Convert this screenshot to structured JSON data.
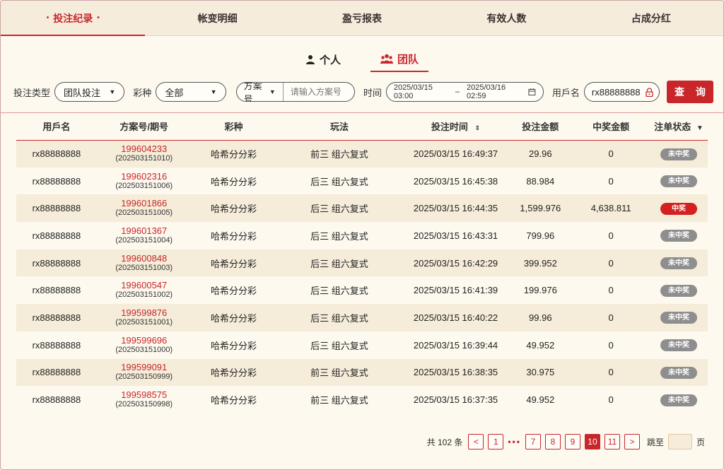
{
  "top_tabs": [
    "投注纪录",
    "帐变明细",
    "盈亏报表",
    "有效人数",
    "占成分红"
  ],
  "scope": {
    "personal": "个人",
    "team": "团队"
  },
  "filters": {
    "bet_type_label": "投注类型",
    "bet_type_value": "团队投注",
    "lottery_label": "彩种",
    "lottery_value": "全部",
    "plan_select": "方案号",
    "plan_placeholder": "请输入方案号",
    "time_label": "时间",
    "time_start": "2025/03/15 03:00",
    "time_sep": "–",
    "time_end": "2025/03/16 02:59",
    "user_label": "用戶名",
    "user_value": "rx88888888",
    "search_label": "查 询"
  },
  "table": {
    "headers": [
      "用戶名",
      "方案号/期号",
      "彩种",
      "玩法",
      "投注时间",
      "投注金额",
      "中奖金额",
      "注单状态"
    ],
    "rows": [
      {
        "user": "rx88888888",
        "order": "199604233",
        "period": "(202503151010)",
        "lottery": "哈希分分彩",
        "play": "前三 组六复式",
        "time": "2025/03/15 16:49:37",
        "bet": "29.96",
        "win": "0",
        "status": "未中奖"
      },
      {
        "user": "rx88888888",
        "order": "199602316",
        "period": "(202503151006)",
        "lottery": "哈希分分彩",
        "play": "后三 组六复式",
        "time": "2025/03/15 16:45:38",
        "bet": "88.984",
        "win": "0",
        "status": "未中奖"
      },
      {
        "user": "rx88888888",
        "order": "199601866",
        "period": "(202503151005)",
        "lottery": "哈希分分彩",
        "play": "后三 组六复式",
        "time": "2025/03/15 16:44:35",
        "bet": "1,599.976",
        "win": "4,638.811",
        "status": "中奖"
      },
      {
        "user": "rx88888888",
        "order": "199601367",
        "period": "(202503151004)",
        "lottery": "哈希分分彩",
        "play": "后三 组六复式",
        "time": "2025/03/15 16:43:31",
        "bet": "799.96",
        "win": "0",
        "status": "未中奖"
      },
      {
        "user": "rx88888888",
        "order": "199600848",
        "period": "(202503151003)",
        "lottery": "哈希分分彩",
        "play": "后三 组六复式",
        "time": "2025/03/15 16:42:29",
        "bet": "399.952",
        "win": "0",
        "status": "未中奖"
      },
      {
        "user": "rx88888888",
        "order": "199600547",
        "period": "(202503151002)",
        "lottery": "哈希分分彩",
        "play": "后三 组六复式",
        "time": "2025/03/15 16:41:39",
        "bet": "199.976",
        "win": "0",
        "status": "未中奖"
      },
      {
        "user": "rx88888888",
        "order": "199599876",
        "period": "(202503151001)",
        "lottery": "哈希分分彩",
        "play": "后三 组六复式",
        "time": "2025/03/15 16:40:22",
        "bet": "99.96",
        "win": "0",
        "status": "未中奖"
      },
      {
        "user": "rx88888888",
        "order": "199599696",
        "period": "(202503151000)",
        "lottery": "哈希分分彩",
        "play": "后三 组六复式",
        "time": "2025/03/15 16:39:44",
        "bet": "49.952",
        "win": "0",
        "status": "未中奖"
      },
      {
        "user": "rx88888888",
        "order": "199599091",
        "period": "(202503150999)",
        "lottery": "哈希分分彩",
        "play": "前三 组六复式",
        "time": "2025/03/15 16:38:35",
        "bet": "30.975",
        "win": "0",
        "status": "未中奖"
      },
      {
        "user": "rx88888888",
        "order": "199598575",
        "period": "(202503150998)",
        "lottery": "哈希分分彩",
        "play": "前三 组六复式",
        "time": "2025/03/15 16:37:35",
        "bet": "49.952",
        "win": "0",
        "status": "未中奖"
      }
    ]
  },
  "pager": {
    "total": "共 102 条",
    "prev": "<",
    "first": "1",
    "ellipsis": "•••",
    "pages": [
      "7",
      "8",
      "9",
      "10",
      "11"
    ],
    "active": "10",
    "next": ">",
    "jump_label": "跳至",
    "page_unit": "页"
  },
  "colors": {
    "accent": "#c8262a",
    "row_alt": "#f5ecd9",
    "badge_lose": "#8e8e8e",
    "badge_win": "#d4201f"
  },
  "icons": [
    "person-icon",
    "team-icon",
    "caret-down-icon",
    "calendar-icon",
    "lock-icon",
    "sort-icon",
    "filter-icon"
  ]
}
